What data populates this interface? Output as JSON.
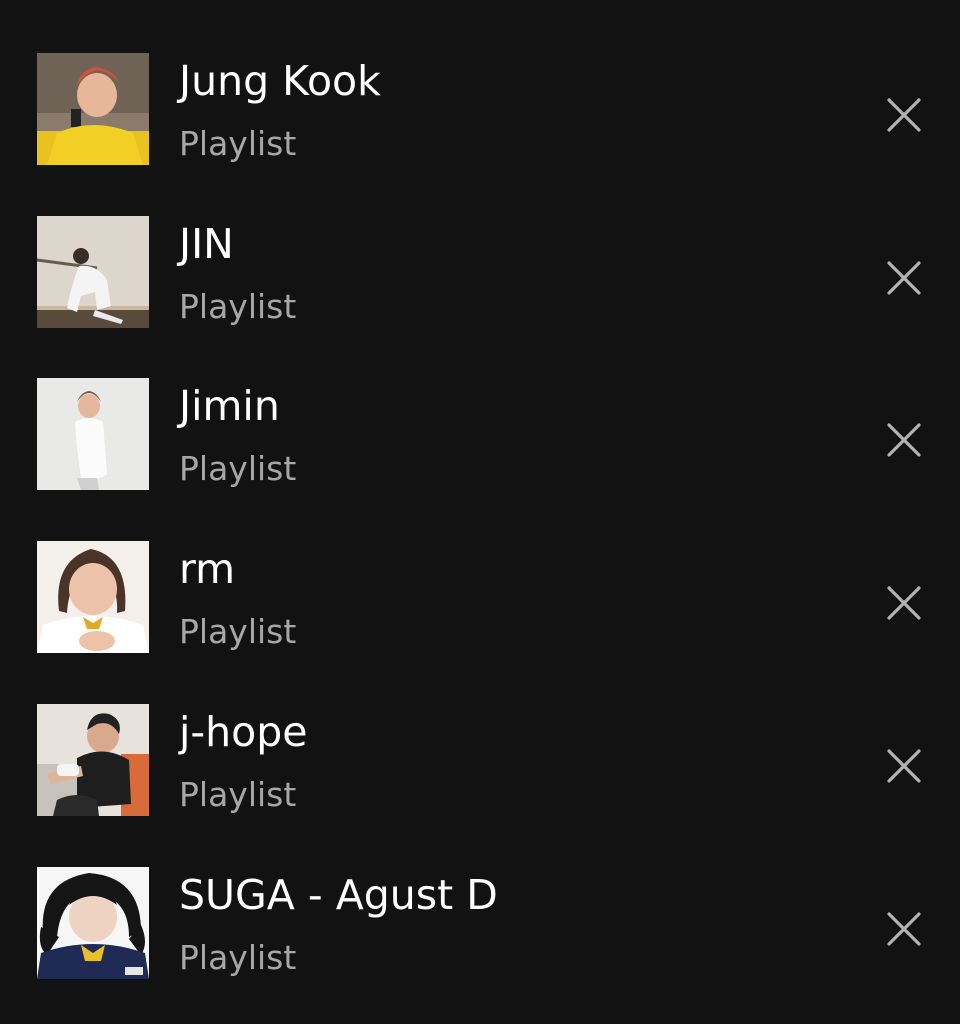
{
  "colors": {
    "background": "#121212",
    "title": "#ffffff",
    "subtitle": "#a7a7a7",
    "remove_icon": "#b3b3b3"
  },
  "items": [
    {
      "title": "Jung Kook",
      "subtitle": "Playlist",
      "icon": "close-icon"
    },
    {
      "title": "JIN",
      "subtitle": "Playlist",
      "icon": "close-icon"
    },
    {
      "title": "Jimin",
      "subtitle": "Playlist",
      "icon": "close-icon"
    },
    {
      "title": "rm",
      "subtitle": "Playlist",
      "icon": "close-icon"
    },
    {
      "title": "j-hope",
      "subtitle": "Playlist",
      "icon": "close-icon"
    },
    {
      "title": "SUGA - Agust D",
      "subtitle": "Playlist",
      "icon": "close-icon"
    }
  ]
}
